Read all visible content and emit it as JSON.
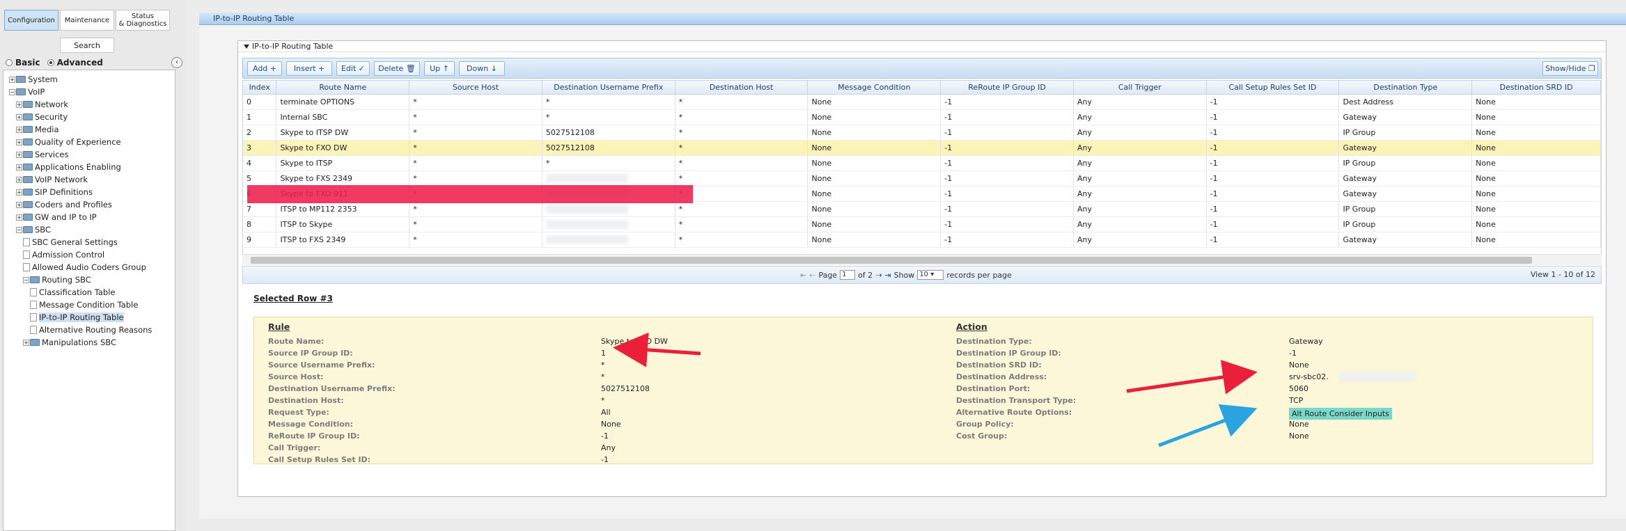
{
  "nav": {
    "tabs": [
      "Configuration",
      "Maintenance",
      "Status\n& Diagnostics"
    ],
    "search_label": "Search",
    "mode_basic": "Basic",
    "mode_advanced": "Advanced",
    "tree": [
      {
        "label": "System",
        "level": 0,
        "kind": "folder",
        "exp": "+"
      },
      {
        "label": "VoIP",
        "level": 0,
        "kind": "folder",
        "exp": "−"
      },
      {
        "label": "Network",
        "level": 1,
        "kind": "folder",
        "exp": "+"
      },
      {
        "label": "Security",
        "level": 1,
        "kind": "folder",
        "exp": "+"
      },
      {
        "label": "Media",
        "level": 1,
        "kind": "folder",
        "exp": "+"
      },
      {
        "label": "Quality of Experience",
        "level": 1,
        "kind": "folder",
        "exp": "+"
      },
      {
        "label": "Services",
        "level": 1,
        "kind": "folder",
        "exp": "+"
      },
      {
        "label": "Applications Enabling",
        "level": 1,
        "kind": "folder",
        "exp": "+"
      },
      {
        "label": "VoIP Network",
        "level": 1,
        "kind": "folder",
        "exp": "+"
      },
      {
        "label": "SIP Definitions",
        "level": 1,
        "kind": "folder",
        "exp": "+"
      },
      {
        "label": "Coders and Profiles",
        "level": 1,
        "kind": "folder",
        "exp": "+"
      },
      {
        "label": "GW and IP to IP",
        "level": 1,
        "kind": "folder",
        "exp": "+"
      },
      {
        "label": "SBC",
        "level": 1,
        "kind": "folder",
        "exp": "−"
      },
      {
        "label": "SBC General Settings",
        "level": 2,
        "kind": "doc"
      },
      {
        "label": "Admission Control",
        "level": 2,
        "kind": "doc"
      },
      {
        "label": "Allowed Audio Coders Group",
        "level": 2,
        "kind": "doc"
      },
      {
        "label": "Routing SBC",
        "level": 2,
        "kind": "folder",
        "exp": "−"
      },
      {
        "label": "Classification Table",
        "level": 3,
        "kind": "doc"
      },
      {
        "label": "Message Condition Table",
        "level": 3,
        "kind": "doc"
      },
      {
        "label": "IP-to-IP Routing Table",
        "level": 3,
        "kind": "doc",
        "selected": true
      },
      {
        "label": "Alternative Routing Reasons",
        "level": 3,
        "kind": "doc"
      },
      {
        "label": "Manipulations SBC",
        "level": 2,
        "kind": "folder",
        "exp": "+"
      }
    ]
  },
  "page": {
    "title": "IP-to-IP Routing Table",
    "card_title": "IP-to-IP Routing Table"
  },
  "toolbar": {
    "add": "Add +",
    "insert": "Insert +",
    "edit": "Edit ✓",
    "delete": "Delete 🗑",
    "up": "Up ↑",
    "down": "Down ↓",
    "show_hide": "Show/Hide ❐"
  },
  "table": {
    "columns": [
      "Index",
      "Route Name",
      "Source Host",
      "Destination Username Prefix",
      "Destination Host",
      "Message Condition",
      "ReRoute IP Group ID",
      "Call Trigger",
      "Call Setup Rules Set ID",
      "Destination Type",
      "Destination SRD ID"
    ],
    "rows": [
      [
        "0",
        "terminate OPTIONS",
        "*",
        "*",
        "*",
        "None",
        "-1",
        "Any",
        "-1",
        "Dest Address",
        "None"
      ],
      [
        "1",
        "Internal SBC",
        "*",
        "*",
        "*",
        "None",
        "-1",
        "Any",
        "-1",
        "Gateway",
        "None"
      ],
      [
        "2",
        "Skype to ITSP DW",
        "*",
        "5027512108",
        "*",
        "None",
        "-1",
        "Any",
        "-1",
        "IP Group",
        "None"
      ],
      [
        "3",
        "Skype to FXO DW",
        "*",
        "5027512108",
        "*",
        "None",
        "-1",
        "Any",
        "-1",
        "Gateway",
        "None"
      ],
      [
        "4",
        "Skype to ITSP",
        "*",
        "*",
        "*",
        "None",
        "-1",
        "Any",
        "-1",
        "IP Group",
        "None"
      ],
      [
        "5",
        "Skype to FXS 2349",
        "*",
        "",
        "*",
        "None",
        "-1",
        "Any",
        "-1",
        "Gateway",
        "None"
      ],
      [
        "6",
        "Skype to FXO 911",
        "*",
        "",
        "*",
        "None",
        "-1",
        "Any",
        "-1",
        "Gateway",
        "None"
      ],
      [
        "7",
        "ITSP to MP112 2353",
        "*",
        "",
        "*",
        "None",
        "-1",
        "Any",
        "-1",
        "IP Group",
        "None"
      ],
      [
        "8",
        "ITSP to Skype",
        "*",
        "",
        "*",
        "None",
        "-1",
        "Any",
        "-1",
        "IP Group",
        "None"
      ],
      [
        "9",
        "ITSP to FXS 2349",
        "*",
        "",
        "*",
        "None",
        "-1",
        "Any",
        "-1",
        "Gateway",
        "None"
      ]
    ],
    "selected_index": 3
  },
  "pager": {
    "page_label": "Page",
    "page_value": "1",
    "of_label": "of 2",
    "show_label": "Show",
    "show_value": "10",
    "records_label": "records per page",
    "view_label": "View 1 - 10 of 12"
  },
  "selected_row": {
    "title": "Selected Row #3",
    "rule_title": "Rule",
    "action_title": "Action",
    "rule": [
      {
        "label": "Route Name:",
        "value": "Skype to FXO DW"
      },
      {
        "label": "Source IP Group ID:",
        "value": "1"
      },
      {
        "label": "Source Username Prefix:",
        "value": "*"
      },
      {
        "label": "Source Host:",
        "value": "*"
      },
      {
        "label": "Destination Username Prefix:",
        "value": "5027512108"
      },
      {
        "label": "Destination Host:",
        "value": "*"
      },
      {
        "label": "Request Type:",
        "value": "All"
      },
      {
        "label": "Message Condition:",
        "value": "None"
      },
      {
        "label": "ReRoute IP Group ID:",
        "value": "-1"
      },
      {
        "label": "Call Trigger:",
        "value": "Any"
      },
      {
        "label": "Call Setup Rules Set ID:",
        "value": "-1"
      }
    ],
    "action": [
      {
        "label": "Destination Type:",
        "value": "Gateway"
      },
      {
        "label": "Destination IP Group ID:",
        "value": "-1"
      },
      {
        "label": "Destination SRD ID:",
        "value": "None"
      },
      {
        "label": "Destination Address:",
        "value": "srv-sbc02."
      },
      {
        "label": "Destination Port:",
        "value": "5060"
      },
      {
        "label": "Destination Transport Type:",
        "value": "TCP"
      },
      {
        "label": "Alternative Route Options:",
        "value": "Alt Route Consider Inputs"
      },
      {
        "label": "Group Policy:",
        "value": "None"
      },
      {
        "label": "Cost Group:",
        "value": "None"
      }
    ]
  },
  "colors": {
    "highlight_row": "#fbf3b7",
    "red_annotation": "#ee1e4d",
    "teal_highlight": "#79d8c9",
    "blue_arrow": "#2ba3e0"
  }
}
